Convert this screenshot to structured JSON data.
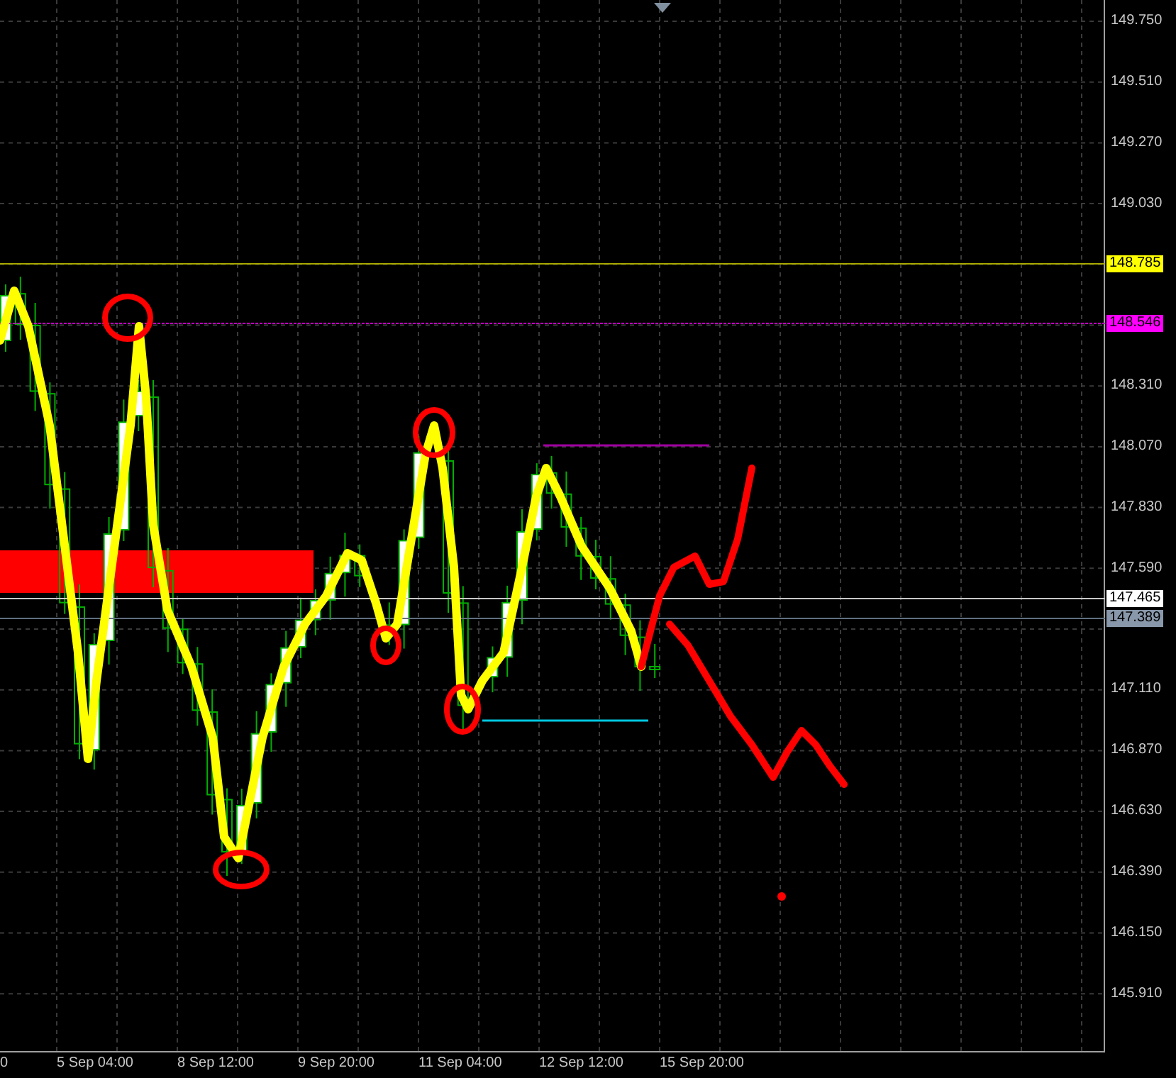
{
  "price_axis": {
    "labels": [
      "149.750",
      "149.510",
      "149.270",
      "149.030",
      "148.310",
      "148.070",
      "147.830",
      "147.590",
      "147.110",
      "146.870",
      "146.630",
      "146.390",
      "146.150",
      "145.910"
    ]
  },
  "price_markers": [
    {
      "label": "148.785",
      "color": "#ffff00"
    },
    {
      "label": "148.546",
      "color": "#ff00ff"
    },
    {
      "label": "147.465",
      "color": "#ffffff"
    },
    {
      "label": "147.389",
      "color": "#8898aa"
    }
  ],
  "time_axis": {
    "labels": [
      "0",
      "5 Sep 04:00",
      "8 Sep 12:00",
      "9 Sep 20:00",
      "11 Sep 04:00",
      "12 Sep 12:00",
      "15 Sep 20:00"
    ]
  }
}
